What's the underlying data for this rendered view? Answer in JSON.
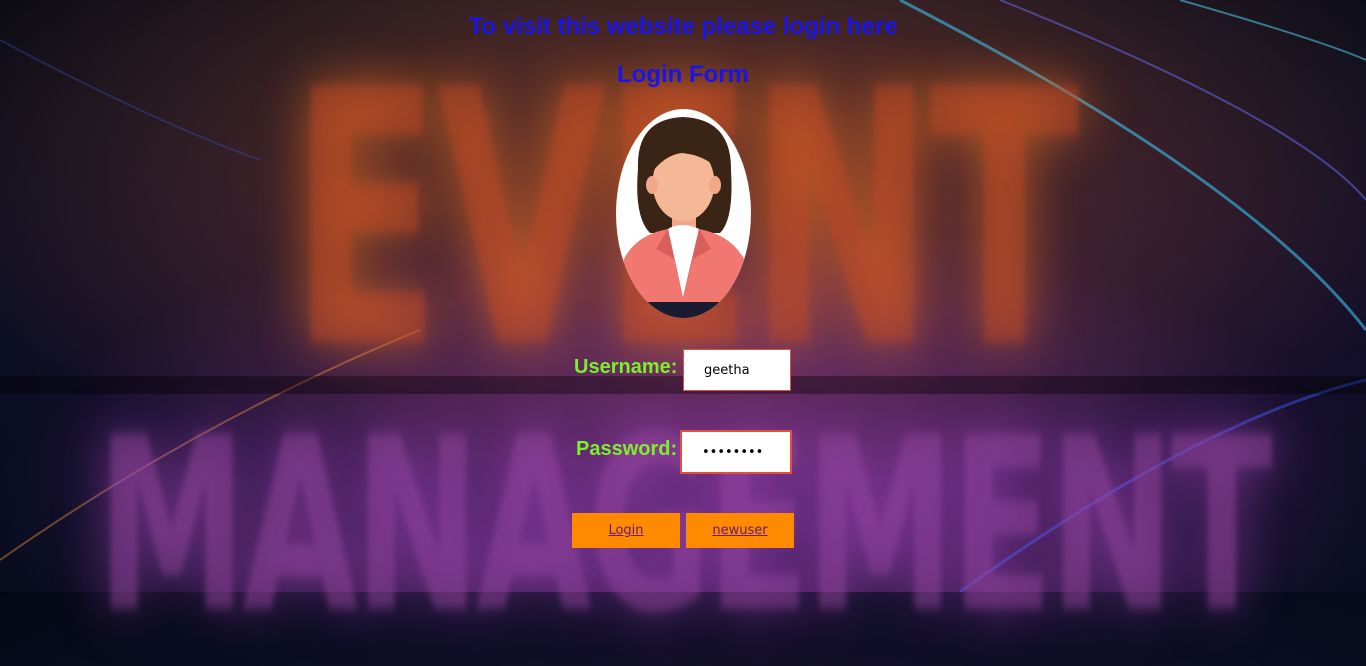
{
  "page": {
    "headline": "To visit this website please login here",
    "form_title": "Login Form",
    "background_words": [
      "EVENT",
      "MANAGEMENT"
    ]
  },
  "form": {
    "username_label": "Username:",
    "username_value": "geetha",
    "password_label": "Password:",
    "password_value": "••••••••",
    "login_button": "Login",
    "newuser_button": "newuser"
  },
  "icons": {
    "avatar": "woman-avatar-icon"
  },
  "colors": {
    "heading": "#1a14e8",
    "labels": "#7cf02a",
    "buttons": "#ff8a00",
    "field_border": "#e0503c"
  }
}
